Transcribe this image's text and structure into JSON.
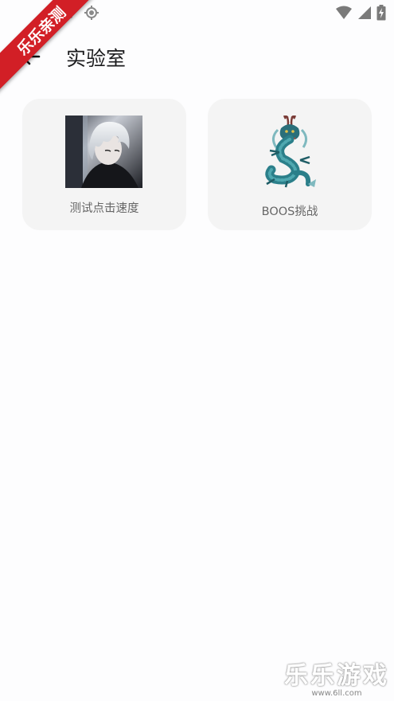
{
  "ribbon": {
    "text": "乐乐亲测",
    "color": "#d21f26"
  },
  "status_bar": {
    "left_icons": [
      "image-icon",
      "crosshair-icon"
    ],
    "right_icons": [
      "wifi-icon",
      "signal-icon",
      "battery-charging-icon"
    ]
  },
  "app_bar": {
    "back_icon": "arrow-left-icon",
    "title": "实验室"
  },
  "cards": [
    {
      "label": "测试点击速度",
      "image": "anime-character-image"
    },
    {
      "label": "BOOS挑战",
      "image": "dragon-image"
    }
  ],
  "watermark": {
    "main": "乐乐游戏",
    "sub": "www.6ll.com"
  },
  "colors": {
    "background": "#fdfdfe",
    "card_background": "#f4f4f4",
    "label_text": "#666666",
    "title_text": "#1c1c1e",
    "ribbon": "#d21f26"
  }
}
